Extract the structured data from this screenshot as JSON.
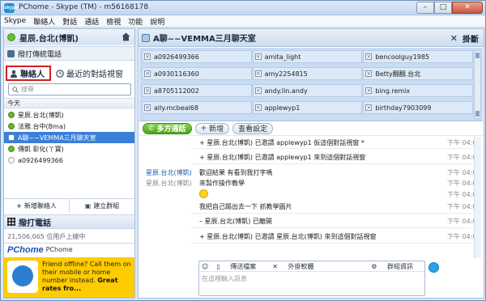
{
  "window": {
    "app_icon_text": "skype",
    "title": "PChome - Skype (TM) - m56168178",
    "buttons": {
      "minimize": "–",
      "maximize": "□",
      "close": "✕"
    }
  },
  "menu": [
    "Skype",
    "聯絡人",
    "對話",
    "通話",
    "檢視",
    "功能",
    "說明"
  ],
  "left": {
    "profile_name": "星辰.台北(博凱)",
    "call_phone": "撥打傳統電話",
    "tab_contacts": "聯絡人",
    "tab_recent": "最近的對話視窗",
    "search_placeholder": "搜尋",
    "section_today": "今天",
    "contacts": [
      {
        "name": "星辰.台北(博凱)",
        "icon": "online"
      },
      {
        "name": "法雅.台中(Bma)",
        "icon": "online"
      },
      {
        "name": "A聊~~VEMMA三月聊天室",
        "icon": "chat",
        "selected": true
      },
      {
        "name": "傳凱 彰化(丫寶)",
        "icon": "online"
      },
      {
        "name": "a0926499366",
        "icon": "offline"
      }
    ],
    "add_contact": "新增聯絡人",
    "create_group": "建立群組",
    "dial": "撥打電話",
    "online_count": "21,506,065 位用戶上線中",
    "brand_logo": "PChome",
    "brand_label": "PChome",
    "ad_text_1": "Friend offline? Call them on their mobile or home number instead.",
    "ad_text_2": "Great rates fro..."
  },
  "chat": {
    "title": "A聊~~VEMMA三月聊天室",
    "hangup": "掛斷",
    "members": [
      [
        "a0926499366",
        "amita_light",
        "bencoolguy1985"
      ],
      [
        "a0930116360",
        "amy2254815",
        "Betty翻翻.台北"
      ],
      [
        "a8705112002",
        "andy.lin.andy",
        "bing.remix"
      ],
      [
        "ally.mcbeal68",
        "applewyp1",
        "birthday7903099"
      ]
    ],
    "btn_multi_call": "多方通話",
    "btn_add": "新增",
    "btn_settings": "查看設定",
    "messages": [
      {
        "sender": "",
        "body": "+ 星辰.台北(博凱) 已邀請 applewyp1 仮這個對話視窗 *",
        "time": "下午 04:06"
      },
      {
        "sender": "",
        "body": "+ 星辰.台北(博凱) 已邀請 applewyp1 來到這個對話視窗",
        "time": "下午 04:06"
      },
      {
        "sender": "星辰.台北(博凱)",
        "body": "歡迎結果 有看到我打字嗎",
        "time": "下午 04:07"
      },
      {
        "sender": "星辰.台北(博凱)",
        "body": "來製作操作教學",
        "time": "下午 04:07"
      },
      {
        "sender": "",
        "body": "",
        "time": "下午 04:07"
      },
      {
        "sender": "",
        "body": "我把自己踢出去一下 抓教學圖片",
        "time": "下午 04:08"
      },
      {
        "sender": "",
        "body": "– 星辰.台北(博凱) 已離開",
        "time": "下午 04:08"
      },
      {
        "sender": "",
        "body": "+ 星辰.台北(博凱) 已邀請 星辰.台北(博凱) 來到這個對話視窗",
        "time": "下午 04:08"
      }
    ],
    "composer_emoticon": "☺",
    "composer_send_file": "傳送檔案",
    "composer_plugins": "外掛軟體",
    "composer_group_info": "群組資訊",
    "composer_placeholder": "在這裡輸入訊息"
  }
}
